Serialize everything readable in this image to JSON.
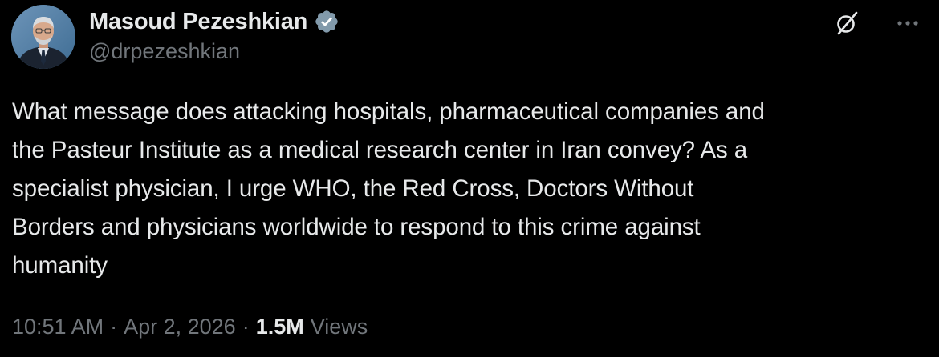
{
  "author": {
    "display_name": "Masoud Pezeshkian",
    "handle": "@drpezeshkian",
    "verified_icon": "verified-badge-icon"
  },
  "actions": {
    "grok_icon": "grok-icon",
    "more_icon": "more-options-icon"
  },
  "tweet": {
    "text": "What message does attacking hospitals, pharmaceutical companies and\nthe Pasteur Institute as a medical research center in Iran convey? As a\nspecialist physician, I urge WHO, the Red Cross, Doctors Without\nBorders and physicians worldwide to respond to this crime against\nhumanity"
  },
  "meta": {
    "time": "10:51 AM",
    "separator_1": "·",
    "date": "Apr 2, 2026",
    "separator_2": "·",
    "views_count": "1.5M",
    "views_label": "Views"
  },
  "colors": {
    "background": "#000000",
    "primary_text": "#e7e9ea",
    "secondary_text": "#71767b",
    "verified_badge": "#829aab"
  }
}
